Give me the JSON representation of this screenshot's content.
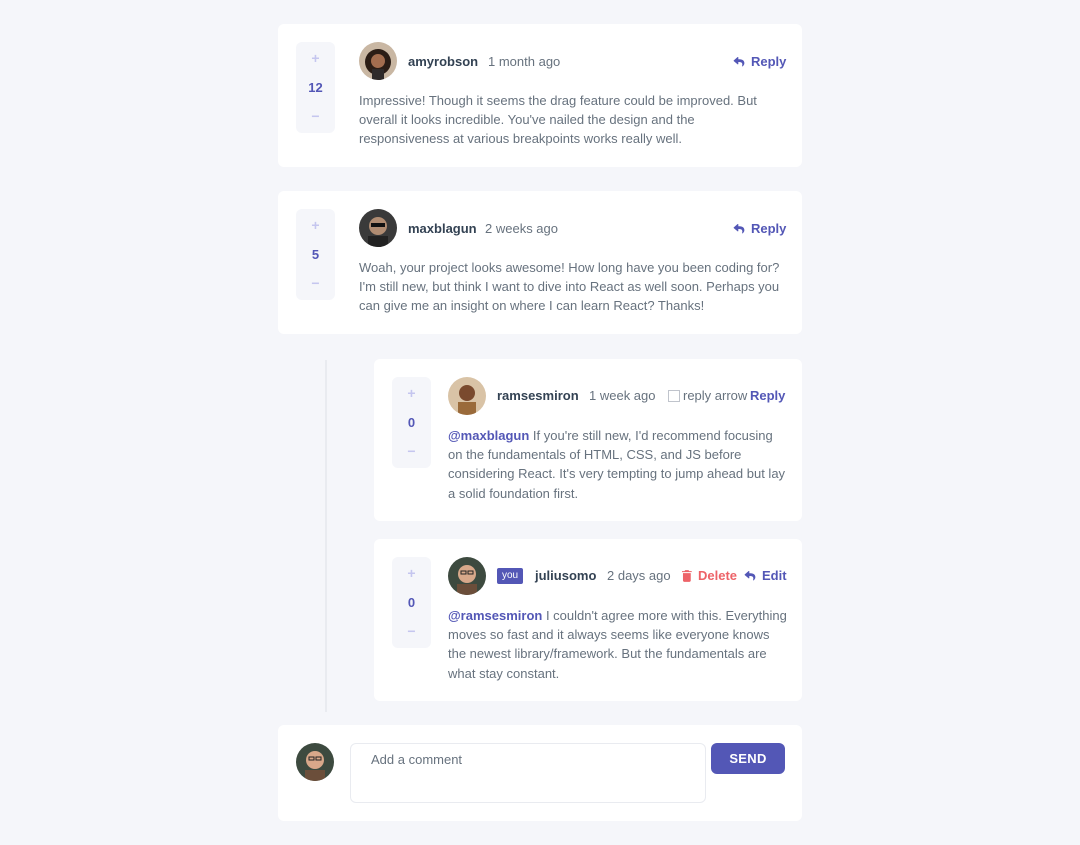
{
  "comments": [
    {
      "score": "12",
      "username": "amyrobson",
      "time": "1 month ago",
      "reply_label": "Reply",
      "content": "Impressive! Though it seems the drag feature could be improved. But overall it looks incredible. You've nailed the design and the responsiveness at various breakpoints works really well."
    },
    {
      "score": "5",
      "username": "maxblagun",
      "time": "2 weeks ago",
      "reply_label": "Reply",
      "content": "Woah, your project looks awesome! How long have you been coding for? I'm still new, but think I want to dive into React as well soon. Perhaps you can give me an insight on where I can learn React? Thanks!"
    }
  ],
  "replies": [
    {
      "score": "0",
      "username": "ramsesmiron",
      "time": "1 week ago",
      "broken_image_alt": "reply arrow",
      "reply_label": "Reply",
      "mention": "@maxblagun",
      "content": " If you're still new, I'd recommend focusing on the fundamentals of HTML, CSS, and JS before considering React. It's very tempting to jump ahead but lay a solid foundation first."
    },
    {
      "score": "0",
      "username": "juliusomo",
      "you_badge": "you",
      "time": "2 days ago",
      "delete_label": "Delete",
      "edit_label": "Edit",
      "mention": "@ramsesmiron",
      "content": " I couldn't agree more with this. Everything moves so fast and it always seems like everyone knows the newest library/framework. But the fundamentals are what stay constant."
    }
  ],
  "vote": {
    "plus": "+",
    "minus": "−"
  },
  "new_comment": {
    "placeholder": "Add a comment",
    "send_label": "SEND"
  },
  "colors": {
    "background": "#f5f6fa",
    "primary": "#5357b6",
    "danger": "#ed6368",
    "vote_light": "#c5c6ef",
    "text": "#67727e",
    "heading": "#334253"
  }
}
